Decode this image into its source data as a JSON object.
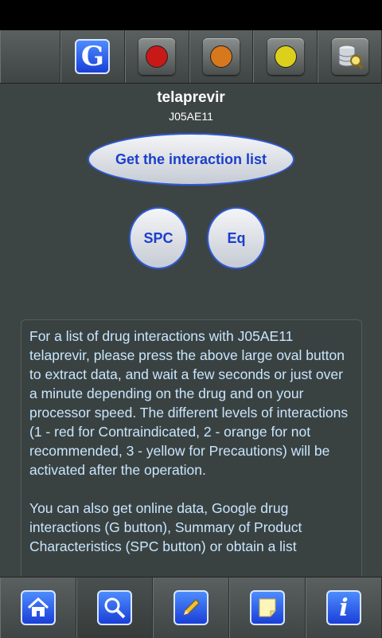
{
  "toolbar": {
    "google_label": "G",
    "dots": [
      {
        "name": "red",
        "color": "#d81e1e"
      },
      {
        "name": "orange",
        "color": "#e07a1a"
      },
      {
        "name": "yellow",
        "color": "#e8d81a"
      }
    ],
    "database_icon": "database-search-icon"
  },
  "drug": {
    "name": "telaprevir",
    "code": "J05AE11"
  },
  "buttons": {
    "interaction_list": "Get the interaction list",
    "spc": "SPC",
    "eq": "Eq"
  },
  "info": {
    "paragraph1": "For a list of drug interactions with J05AE11 telaprevir, please press the above large oval button to extract data, and wait a few seconds or just over a minute depending on the drug and on your processor speed. The different levels of interactions (1 - red for Contraindicated, 2 - orange for not recommended, 3 - yellow for Precautions) will be activated after the operation.",
    "paragraph2": "You can also get online data, Google drug interactions (G button), Summary of Product Characteristics (SPC button)  or obtain a list"
  },
  "bottombar": {
    "icons": [
      "home-icon",
      "search-icon",
      "pencil-icon",
      "note-icon",
      "info-icon"
    ],
    "info_label": "i"
  }
}
